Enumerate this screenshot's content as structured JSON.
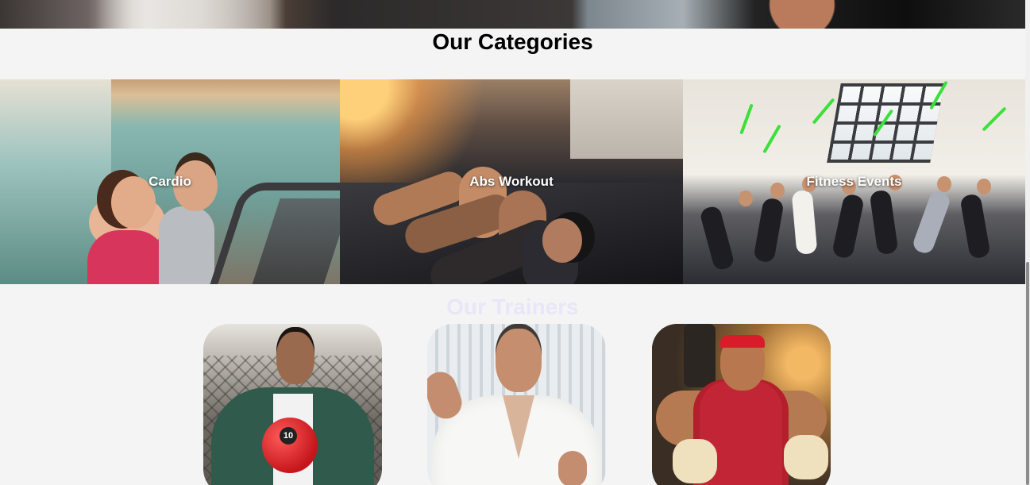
{
  "categories": {
    "title": "Our Categories",
    "items": [
      {
        "label": "Cardio"
      },
      {
        "label": "Abs Workout"
      },
      {
        "label": "Fitness Events"
      }
    ]
  },
  "trainers": {
    "title": "Our Trainers",
    "items": [
      {
        "ball_number": "10"
      },
      {},
      {}
    ]
  }
}
